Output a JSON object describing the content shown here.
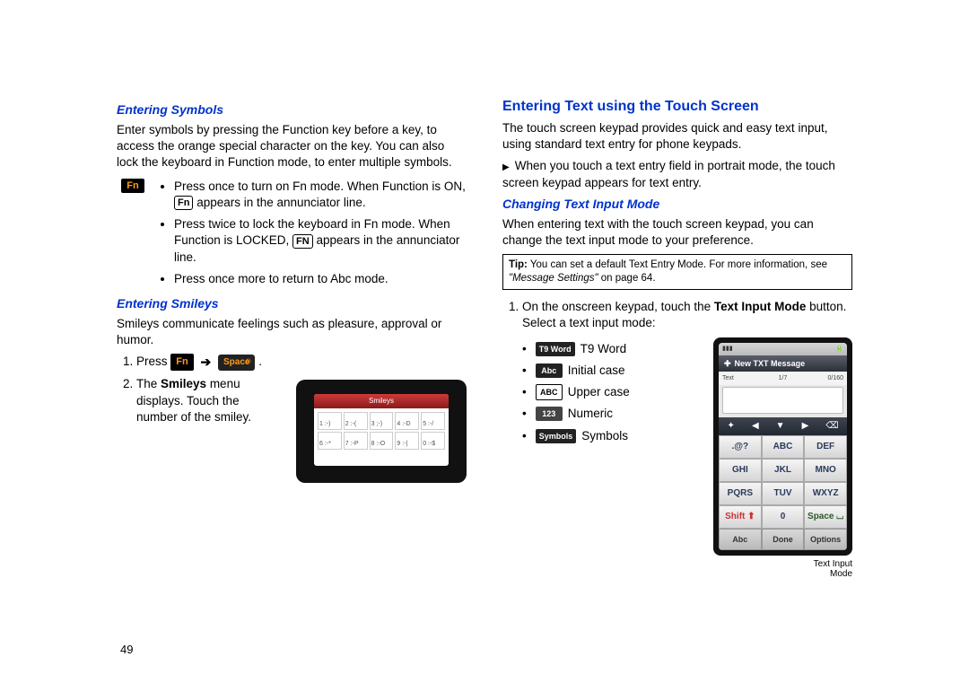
{
  "page_number": "49",
  "left": {
    "symbols_heading": "Entering Symbols",
    "symbols_intro": "Enter symbols by pressing the Function key before a key, to access the orange special character on the key. You can also lock the keyboard in Function mode, to enter multiple symbols.",
    "fn_badge": "Fn",
    "fn_items": {
      "b1a": "Press once to turn on Fn mode. When Function is ON, ",
      "b1_key": "Fn",
      "b1b": " appears in the annunciator line.",
      "b2a": "Press twice to lock the keyboard in Fn mode. When Function is LOCKED, ",
      "b2_key": "FN",
      "b2b": " appears in the annunciator line.",
      "b3": "Press once more to return to Abc mode."
    },
    "smileys_heading": "Entering Smileys",
    "smileys_intro": "Smileys communicate feelings such as pleasure, approval or humor.",
    "step1_press": "Press ",
    "step1_fn": "Fn",
    "step1_space": "Space",
    "step1_period": ".",
    "step2a": "The ",
    "step2b": "Smileys",
    "step2c": " menu displays. Touch the number of the smiley.",
    "phone_title": "Smileys",
    "grid": [
      "1 :-)",
      "2 :-(",
      "3 ;-)",
      "4 :-D",
      "5 :-/",
      "6 :-*",
      "7 :-P",
      "8 :-O",
      "9 :-|",
      "0 :-$"
    ]
  },
  "right": {
    "touch_heading": "Entering Text using the Touch Screen",
    "touch_p1": "The touch screen keypad provides quick and easy text input, using standard text entry for phone keypads.",
    "touch_p2": "When you touch a text entry field in portrait mode, the touch screen keypad appears for text entry.",
    "changing_heading": "Changing Text Input Mode",
    "changing_p1": "When entering text with the touch screen keypad, you can change the text input mode to your preference.",
    "tip_label": "Tip:",
    "tip_text": " You can set a default Text Entry Mode. For more information, see ",
    "tip_ref": "\"Message Settings\"",
    "tip_page": " on page 64.",
    "step1a": "On the onscreen keypad, touch the ",
    "step1b": "Text Input Mode",
    "step1c": " button. Select a text input mode:",
    "modes": {
      "t9_badge": "T9 Word",
      "t9_label": "T9 Word",
      "abc_badge": "Abc",
      "abc_label": "Initial case",
      "ABC_badge": "ABC",
      "ABC_label": "Upper case",
      "num_badge": "123",
      "num_label": "Numeric",
      "sym_badge": "Symbols",
      "sym_label": "Symbols"
    },
    "caption1": "Text Input",
    "caption2": "Mode",
    "phone": {
      "title": "New TXT Message",
      "field_label": "Text",
      "field_mid": "1/7",
      "field_right": "0/160",
      "keys": [
        ".@?",
        "ABC",
        "DEF",
        "GHI",
        "JKL",
        "MNO",
        "PQRS",
        "TUV",
        "WXYZ"
      ],
      "bottom_row": [
        "Shift ⬆",
        "0",
        "Space ⌴"
      ],
      "softkeys": [
        "Abc",
        "Done",
        "Options"
      ]
    }
  }
}
